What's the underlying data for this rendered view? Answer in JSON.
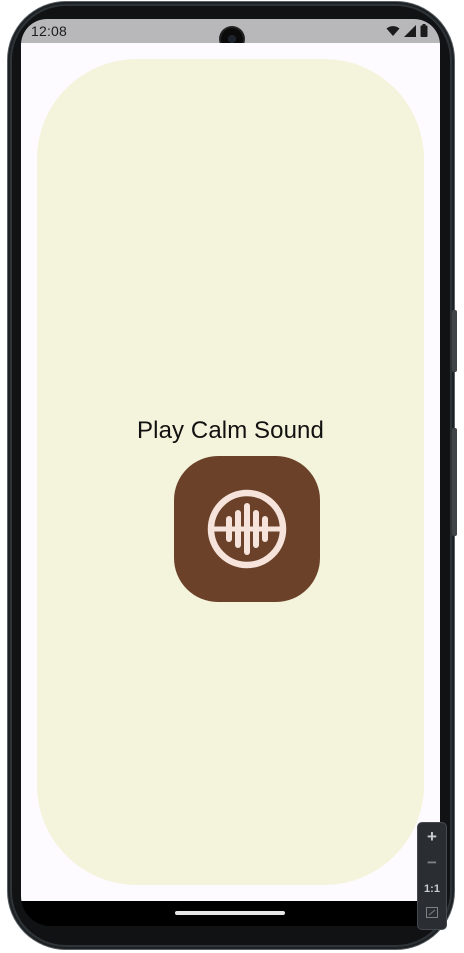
{
  "status_bar": {
    "time": "12:08",
    "icons": [
      "wifi-icon",
      "signal-icon",
      "battery-icon"
    ]
  },
  "app": {
    "title": "Play Calm Sound",
    "play_button_icon": "sound-wave-icon",
    "colors": {
      "background": "#fdfbff",
      "card": "#f4f4dc",
      "button": "#6b4229",
      "icon": "#f6e4dc"
    }
  },
  "emulator_controls": {
    "zoom_in": "+",
    "zoom_out": "−",
    "actual_size": "1:1"
  }
}
